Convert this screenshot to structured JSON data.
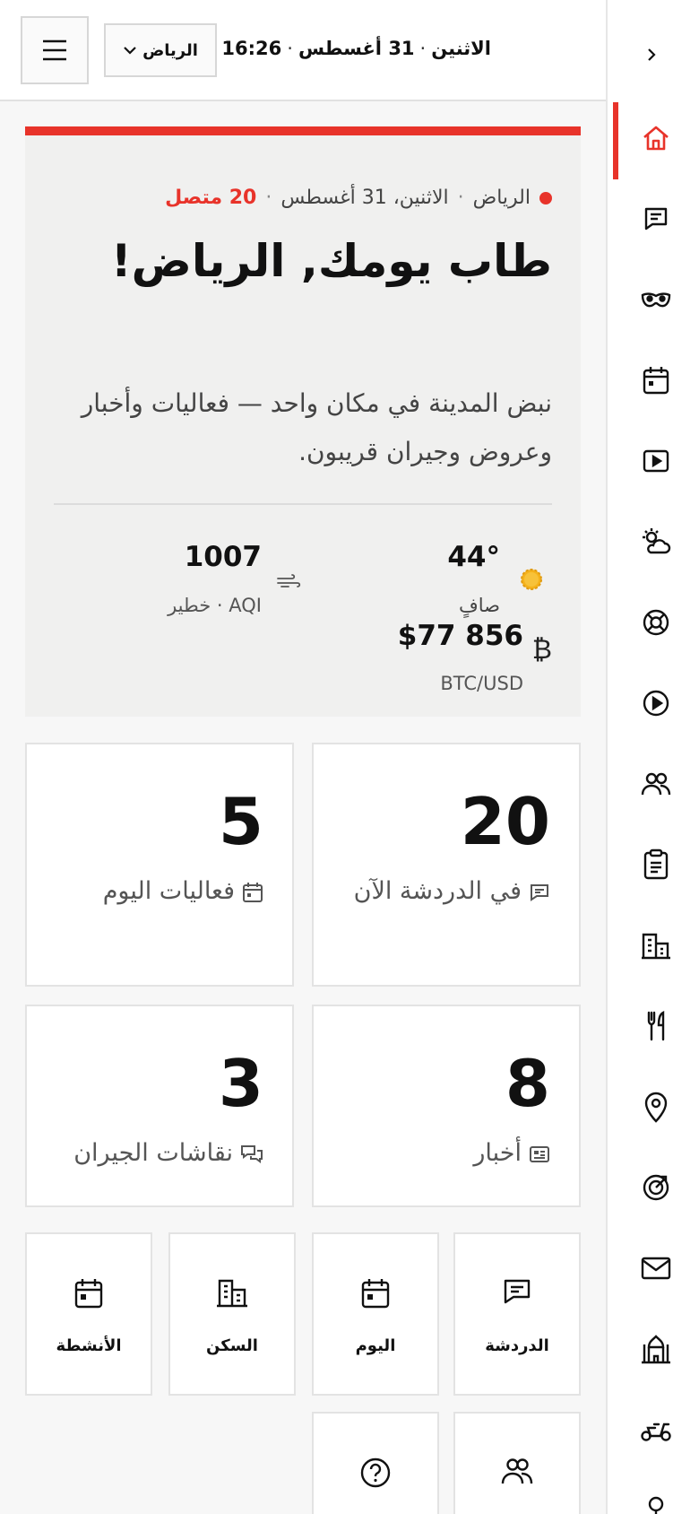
{
  "header": {
    "city_select": "الرياض",
    "day": "الاثنين",
    "date": "31 أغسطس",
    "time": "16:26"
  },
  "rail": {
    "items": [
      {
        "icon": "home-icon",
        "active": true
      },
      {
        "icon": "chat-icon"
      },
      {
        "icon": "mask-icon"
      },
      {
        "icon": "calendar-icon"
      },
      {
        "icon": "video-icon"
      },
      {
        "icon": "weather-icon"
      },
      {
        "icon": "lifebuoy-icon"
      },
      {
        "icon": "play-circle-icon"
      },
      {
        "icon": "people-icon"
      },
      {
        "icon": "clipboard-icon"
      },
      {
        "icon": "buildings-icon"
      },
      {
        "icon": "restaurant-icon"
      },
      {
        "icon": "map-pin-icon"
      },
      {
        "icon": "target-icon"
      },
      {
        "icon": "mail-icon"
      },
      {
        "icon": "mosque-icon"
      },
      {
        "icon": "scooter-icon"
      },
      {
        "icon": "pin-icon"
      }
    ]
  },
  "hero": {
    "city": "الرياض",
    "date": "الاثنين، 31 أغسطس",
    "online": "20 متصل",
    "title": "طاب يومك, الرياض!",
    "subtitle": "نبض المدينة في مكان واحد — فعاليات وأخبار وعروض وجيران قريبون.",
    "weather": {
      "temp": "44°",
      "condition": "صافٍ"
    },
    "aqi": {
      "value": "1007",
      "label": "AQI · خطير"
    },
    "btc": {
      "value": "$77 856",
      "label": "BTC/USD"
    }
  },
  "stats": [
    {
      "value": "20",
      "label": "في الدردشة الآن",
      "icon": "chat-icon"
    },
    {
      "value": "5",
      "label": "فعاليات اليوم",
      "icon": "calendar-icon"
    },
    {
      "value": "8",
      "label": "أخبار",
      "icon": "newspaper-icon"
    },
    {
      "value": "3",
      "label": "نقاشات الجيران",
      "icon": "discussion-icon"
    }
  ],
  "tiles": [
    {
      "label": "الدردشة",
      "icon": "chat-icon"
    },
    {
      "label": "اليوم",
      "icon": "calendar-icon"
    },
    {
      "label": "السكن",
      "icon": "buildings-icon"
    },
    {
      "label": "الأنشطة",
      "icon": "calendar-icon"
    },
    {
      "label": "",
      "icon": "people-icon"
    },
    {
      "label": "",
      "icon": "help-icon"
    }
  ],
  "colors": {
    "accent": "#e8332a",
    "card": "#ffffff",
    "hero_bg": "#f0f0ef"
  }
}
